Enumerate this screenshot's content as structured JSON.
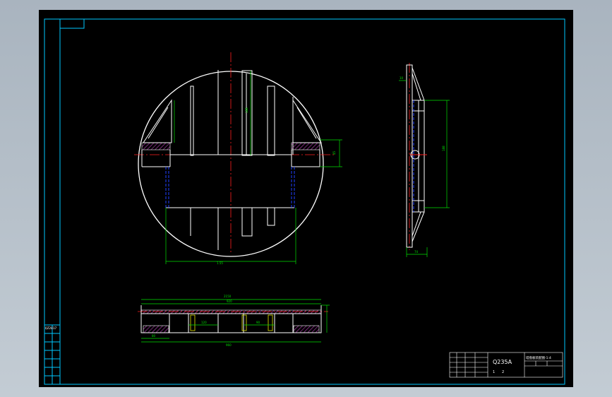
{
  "title_block": {
    "material": "Q235A",
    "drawing_name": "塔盘板装配图-1:4",
    "scale_a": "1",
    "scale_b": "2",
    "left_strip": [
      "QZ2017",
      "",
      "",
      "",
      "",
      ""
    ]
  },
  "dimensions": {
    "front_inner_width": "1.55",
    "front_center_height": "188",
    "right_stub": "45",
    "side_height": "188",
    "side_bottom": "74",
    "side_top": "10",
    "bottom_overall": "2150",
    "bottom_inner": "920",
    "bottom_left": "80",
    "bottom_seg_1": "120",
    "bottom_seg_2": "90",
    "bottom_total": "960"
  },
  "colors": {
    "background": "#000000",
    "frame": "#00c8ff",
    "geometry": "#ffffff",
    "dimension": "#00e000",
    "centerline": "#ff2020",
    "hatch": "#c040c0",
    "hidden": "#2040ff",
    "yellow": "#e6e600"
  }
}
